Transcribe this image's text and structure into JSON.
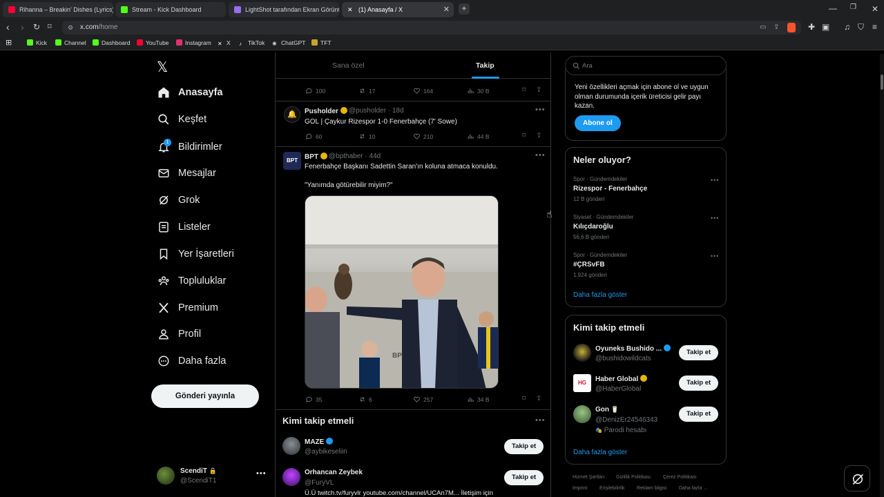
{
  "browser": {
    "tabs": [
      {
        "title": "Rihanna – Breakin' Dishes (Lyrics)",
        "icon_color": "#ff0033",
        "active": false
      },
      {
        "title": "Stream - Kick Dashboard",
        "icon_color": "#53fc18",
        "active": false
      },
      {
        "title": "LightShot tarafından Ekran Görüntüsü",
        "icon_color": "#9a6cf0",
        "active": false
      },
      {
        "title": "(1) Anasayfa / X",
        "icon_color": "#ffffff",
        "active": true
      }
    ],
    "url_host": "x.com",
    "url_path": "/home",
    "bookmarks": [
      {
        "label": "Kick",
        "color": "#53fc18"
      },
      {
        "label": "Channel",
        "color": "#53fc18"
      },
      {
        "label": "Dashboard",
        "color": "#53fc18"
      },
      {
        "label": "YouTube",
        "color": "#ff0033"
      },
      {
        "label": "Instagram",
        "color": "#e1306c"
      },
      {
        "label": "X",
        "color": "#ffffff"
      },
      {
        "label": "TikTok",
        "color": "#ffffff"
      },
      {
        "label": "ChatGPT",
        "color": "#cccccc"
      },
      {
        "label": "TFT",
        "color": "#c9a227"
      }
    ]
  },
  "nav": {
    "items": [
      {
        "label": "Anasayfa",
        "icon": "home-icon"
      },
      {
        "label": "Keşfet",
        "icon": "search-icon"
      },
      {
        "label": "Bildirimler",
        "icon": "bell-icon",
        "badge": "1"
      },
      {
        "label": "Mesajlar",
        "icon": "mail-icon"
      },
      {
        "label": "Grok",
        "icon": "grok-icon"
      },
      {
        "label": "Listeler",
        "icon": "list-icon"
      },
      {
        "label": "Yer İşaretleri",
        "icon": "bookmark-icon"
      },
      {
        "label": "Topluluklar",
        "icon": "communities-icon"
      },
      {
        "label": "Premium",
        "icon": "x-logo-icon"
      },
      {
        "label": "Profil",
        "icon": "profile-icon"
      },
      {
        "label": "Daha fazla",
        "icon": "more-circle-icon"
      }
    ],
    "post_button": "Gönderi yayınla",
    "account": {
      "name": "ScendiT",
      "handle": "@ScendiT1"
    }
  },
  "timeline": {
    "tabs": [
      "Sana özel",
      "Takip"
    ],
    "active_tab": "Takip",
    "top_tweet_actions": {
      "replies": "100",
      "retweets": "17",
      "likes": "164",
      "views": "30 B"
    },
    "tweets": [
      {
        "name": "Pusholder",
        "handle": "@pusholder",
        "time": "18d",
        "text": "GOL | Çaykur Rizespor 1-0 Fenerbahçe (7' Sowe)",
        "replies": "60",
        "retweets": "10",
        "likes": "210",
        "views": "44 B"
      },
      {
        "name": "BPT",
        "handle": "@bpthaber",
        "time": "44d",
        "text": "Fenerbahçe Başkanı Sadettin Saran'ın koluna atmaca konuldu.",
        "text2": "\"Yanımda götürebilir miyim?\"",
        "replies": "35",
        "retweets": "6",
        "likes": "257",
        "views": "34 B",
        "watermark": "BPT"
      }
    ],
    "who_to_follow": {
      "title": "Kimi takip etmeli",
      "follow_label": "Takip et",
      "users": [
        {
          "name": "MAZE",
          "handle": "@aybikeseliin"
        },
        {
          "name": "Orhancan Zeybek",
          "handle": "@FuryVL",
          "bio": "Ü.Ü twitch.tv/furyvlr youtube.com/channel/UCAn7M... İletişim için"
        }
      ]
    }
  },
  "sidebar": {
    "search_placeholder": "Ara",
    "premium": {
      "text": "Yeni özellikleri açmak için abone ol ve uygun olman durumunda içerik üreticisi gelir payı kazan.",
      "button": "Abone ol"
    },
    "trends": {
      "title": "Neler oluyor?",
      "items": [
        {
          "category": "Spor · Gündemdekiler",
          "name": "Rizespor - Fenerbahçe",
          "count": "12 B gönderi"
        },
        {
          "category": "Siyaset · Gündemdekiler",
          "name": "Kılıçdaroğlu",
          "count": "56,6 B gönderi"
        },
        {
          "category": "Spor · Gündemdekiler",
          "name": "#ÇRSvFB",
          "count": "1.924 gönderi"
        }
      ],
      "show_more": "Daha fazla göster"
    },
    "follow": {
      "title": "Kimi takip etmeli",
      "button": "Takip et",
      "users": [
        {
          "name": "Oyuneks Bushido ...",
          "handle": "@bushidowildcats"
        },
        {
          "name": "Haber Global",
          "handle": "@HaberGlobal"
        },
        {
          "name": "Gon",
          "handle": "@DenizEr24546343",
          "note": "Parodi hesabı"
        }
      ],
      "show_more": "Daha fazla göster"
    },
    "footer": [
      "Hizmet Şartları",
      "Gizlilik Politikası",
      "Çerez Politikası",
      "Imprint",
      "Erişilebilirlik",
      "Reklam bilgisi",
      "Daha fazla ..."
    ]
  }
}
